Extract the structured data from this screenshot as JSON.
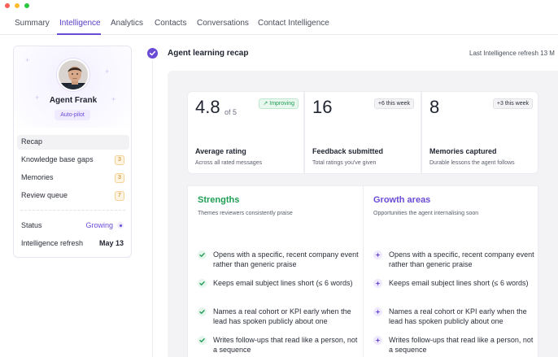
{
  "window": {
    "dot_colors": [
      "#fe5f57",
      "#febc2e",
      "#28c840"
    ]
  },
  "nav": {
    "tabs": [
      {
        "label": "Summary",
        "active": false
      },
      {
        "label": "Intelligence",
        "active": true
      },
      {
        "label": "Analytics",
        "active": false
      },
      {
        "label": "Contacts",
        "active": false
      },
      {
        "label": "Conversations",
        "active": false
      },
      {
        "label": "Contact Intelligence",
        "active": false
      }
    ]
  },
  "sidebar": {
    "agent_name": "Agent Frank",
    "mode_badge": "Auto-pilot",
    "menu": [
      {
        "label": "Recap",
        "count": null,
        "active": true
      },
      {
        "label": "Knowledge base gaps",
        "count": "3",
        "active": false
      },
      {
        "label": "Memories",
        "count": "3",
        "active": false
      },
      {
        "label": "Review queue",
        "count": "7",
        "active": false
      }
    ],
    "status_label": "Status",
    "status_value": "Growing",
    "refresh_label": "Intelligence refresh",
    "refresh_value": "May 13"
  },
  "recap": {
    "title": "Agent learning recap",
    "last_refresh": "Last Intelligence refresh 13 M",
    "stats": [
      {
        "value": "4.8",
        "suffix": "of 5",
        "pill": "Improving",
        "pill_style": "green",
        "label": "Average rating",
        "sub": "Across all rated messages"
      },
      {
        "value": "16",
        "suffix": "",
        "pill": "+6 this week",
        "pill_style": "gray",
        "label": "Feedback submitted",
        "sub": "Total ratings you've given"
      },
      {
        "value": "8",
        "suffix": "",
        "pill": "+3 this week",
        "pill_style": "gray",
        "label": "Memories captured",
        "sub": "Durable lessons the agent follows"
      }
    ],
    "strengths": {
      "title": "Strengths",
      "subtitle": "Themes reviewers consistently praise",
      "color": "#1f9d55",
      "items": [
        "Opens with a specific, recent company event rather than generic praise",
        "Keeps email subject lines short (≤ 6 words)",
        "Names a real cohort or KPI early when the lead has spoken publicly about one",
        "Writes follow-ups that read like a person, not a sequence"
      ]
    },
    "growth": {
      "title": "Growth areas",
      "subtitle": "Opportunities the agent internalising soon",
      "color": "#6a4bd6",
      "items": [
        "Opens with a specific, recent company event rather than generic praise",
        "Keeps email subject lines short (≤ 6 words)",
        "Names a real cohort or KPI early when the lead has spoken publicly about one",
        "Writes follow-ups that read like a person, not a sequence"
      ]
    }
  }
}
